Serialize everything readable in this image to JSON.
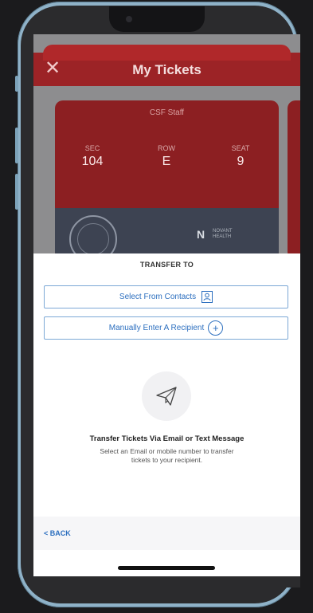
{
  "header": {
    "title": "My Tickets",
    "close_icon": "close-icon"
  },
  "ticket": {
    "holder": "CSF Staff",
    "section_label": "SEC",
    "section_value": "104",
    "row_label": "ROW",
    "row_value": "E",
    "seat_label": "SEAT",
    "seat_value": "9",
    "sponsor_logo": "N",
    "sponsor_text_1": "NOVANT",
    "sponsor_text_2": "HEALTH"
  },
  "sheet": {
    "title": "TRANSFER TO",
    "select_contacts_label": "Select From Contacts",
    "manual_entry_label": "Manually Enter A Recipient",
    "info_title": "Transfer Tickets Via Email or Text Message",
    "info_body": "Select an Email or mobile number to transfer tickets to your recipient."
  },
  "footer": {
    "back_label": "< BACK"
  },
  "colors": {
    "brand_red": "#9c2326",
    "link_blue": "#2c6fbf",
    "frame_blue": "#8fb2c8"
  }
}
